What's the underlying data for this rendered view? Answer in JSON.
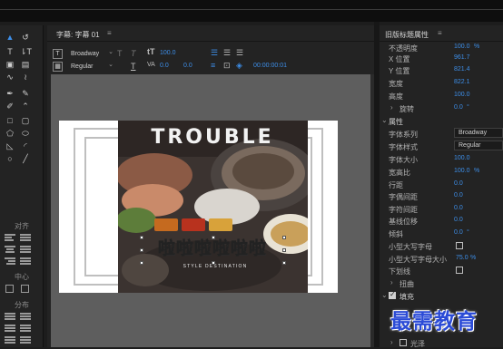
{
  "center_panel": {
    "tab_title": "字幕: 字幕 01",
    "font_family": "Broadway",
    "font_style": "Regular",
    "font_size": "100.0",
    "kerning": "0.0",
    "leading": "0.0",
    "tracking": "0.0",
    "timecode": "00:00:00:01"
  },
  "title_preview": {
    "title": "TROUBLE",
    "chinese_line": "啦啦啦啦啦啦",
    "subtitle": "STYLE DESTINATION"
  },
  "tools_panel": {
    "align_label": "对齐",
    "center_label": "中心",
    "distribute_label": "分布"
  },
  "properties_panel": {
    "title": "旧版标题属性",
    "rows": [
      {
        "label": "不透明度",
        "value": "100.0",
        "unit": "%"
      },
      {
        "label": "X 位置",
        "value": "961.7"
      },
      {
        "label": "Y 位置",
        "value": "821.4"
      },
      {
        "label": "宽度",
        "value": "822.1"
      },
      {
        "label": "高度",
        "value": "100.0"
      },
      {
        "label": "旋转",
        "value": "0.0",
        "unit": "°"
      }
    ],
    "section_properties": "属性",
    "font_family_label": "字体系列",
    "font_family_value": "Broadway",
    "font_style_label": "字体样式",
    "font_style_value": "Regular",
    "attr_rows": [
      {
        "label": "字体大小",
        "value": "100.0"
      },
      {
        "label": "宽高比",
        "value": "100.0",
        "unit": "%"
      },
      {
        "label": "行距",
        "value": "0.0"
      },
      {
        "label": "字偶间距",
        "value": "0.0"
      },
      {
        "label": "字符间距",
        "value": "0.0"
      },
      {
        "label": "基线位移",
        "value": "0.0"
      },
      {
        "label": "倾斜",
        "value": "0.0",
        "unit": "°"
      }
    ],
    "small_caps_label": "小型大写字母",
    "small_caps_size_label": "小型大写字母大小",
    "small_caps_size_value": "75.0",
    "small_caps_size_unit": "%",
    "underline_label": "下划线",
    "distort_label": "扭曲",
    "fill_label": "填充",
    "sheen_label": "光泽"
  },
  "watermark": "最需教育",
  "colors": {
    "accent": "#3d8ee8",
    "panel": "#232323",
    "canvas_bg": "#5e5e5e"
  }
}
